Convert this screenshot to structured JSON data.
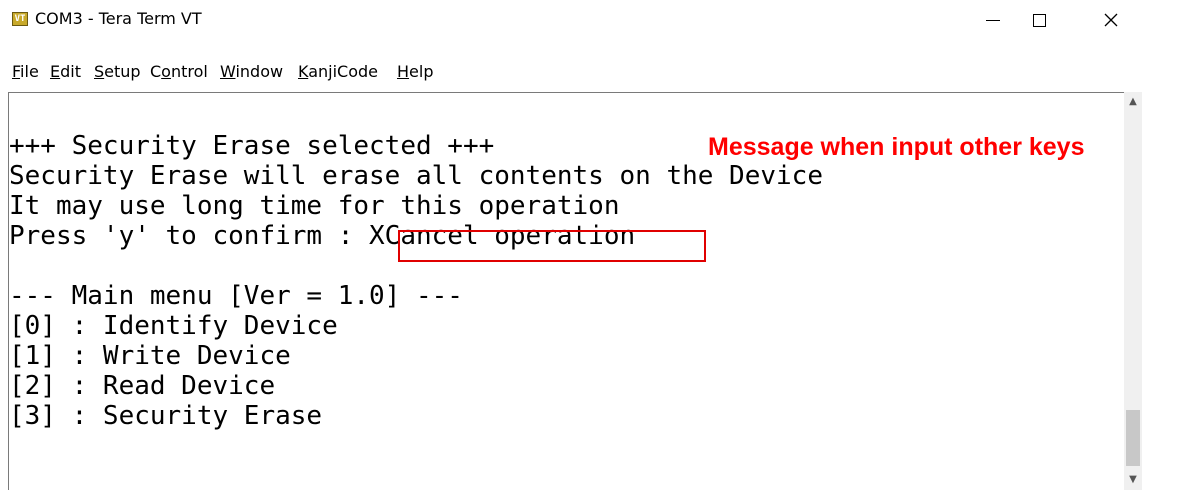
{
  "window": {
    "title": "COM3 - Tera Term VT",
    "icon_text": "VT"
  },
  "menubar": {
    "items": [
      {
        "key": "F",
        "rest": "ile"
      },
      {
        "key": "E",
        "rest": "dit"
      },
      {
        "key": "S",
        "rest": "etup"
      },
      {
        "pre": "C",
        "key": "o",
        "rest": "ntrol"
      },
      {
        "key": "W",
        "rest": "indow"
      },
      {
        "key": "K",
        "rest": "anjiCode"
      },
      {
        "key": "H",
        "rest": "elp"
      }
    ]
  },
  "terminal": {
    "lines": [
      "+++ Security Erase selected +++",
      "Security Erase will erase all contents on the Device",
      "It may use long time for this operation",
      "Press 'y' to confirm : XCancel operation",
      "",
      "--- Main menu [Ver = 1.0] ---",
      "[0] : Identify Device",
      "[1] : Write Device",
      "[2] : Read Device",
      "[3] : Security Erase"
    ]
  },
  "annotation": {
    "text": "Message when input other keys",
    "color": "#ff0000"
  },
  "icons": {
    "minimize": "minimize-icon",
    "maximize": "maximize-icon",
    "close": "close-icon",
    "scroll_up": "chevron-up-icon",
    "scroll_down": "chevron-down-icon"
  }
}
